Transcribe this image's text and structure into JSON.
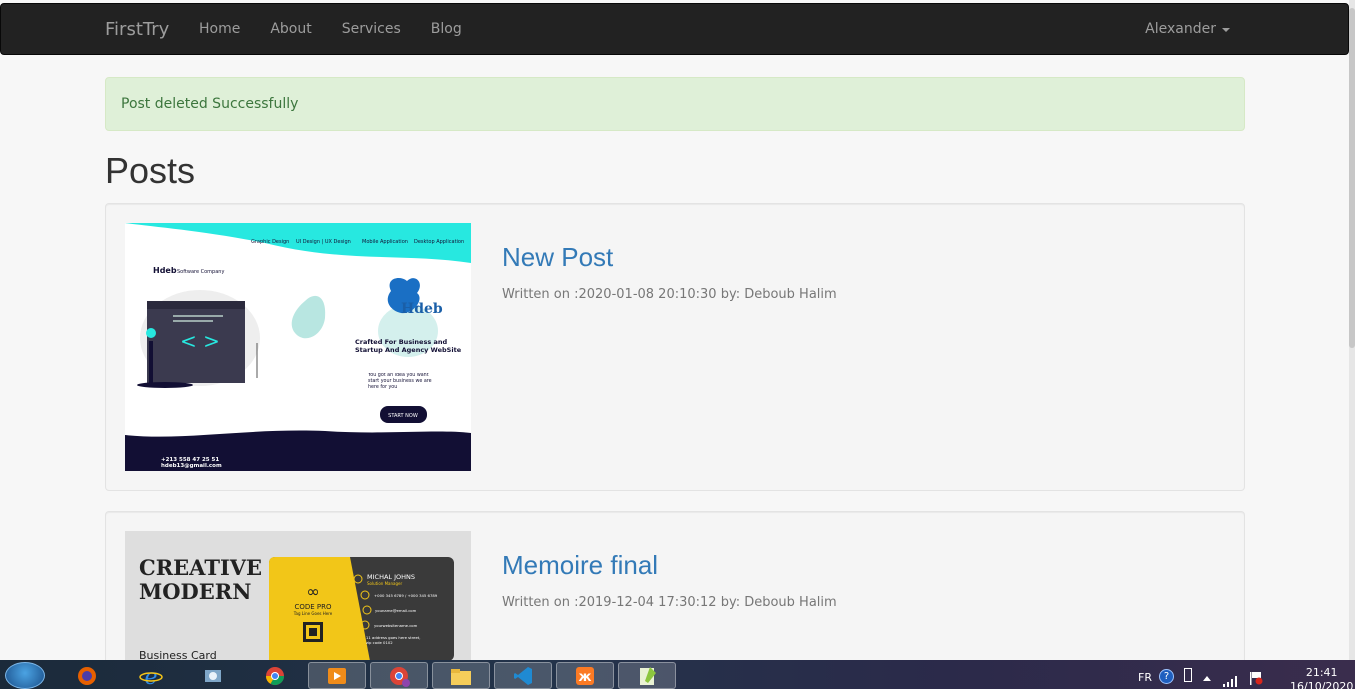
{
  "navbar": {
    "brand": "FirstTry",
    "links": [
      "Home",
      "About",
      "Services",
      "Blog"
    ],
    "user": "Alexander"
  },
  "alert": {
    "message": "Post deleted Successfully"
  },
  "page": {
    "title": "Posts"
  },
  "posts": [
    {
      "title": "New Post",
      "meta": "Written on :2020-01-08 20:10:30 by: Deboub Halim",
      "image": {
        "nav": [
          "Graphic Design",
          "UI Design | UX Design",
          "Mobile Application",
          "Desktop Application"
        ],
        "brand_small": "Hdeb",
        "brand_small_suffix": "Software Company",
        "logo_text": "Hdeb",
        "headline": "Crafted For Business and Startup And Agency WebSite",
        "subtext": "You got an idea you want start your business we are here for you",
        "cta": "START NOW",
        "phone": "+213 558 47 25 51",
        "email": "hdeb13@gmail.com"
      }
    },
    {
      "title": "Memoire final",
      "meta": "Written on :2019-12-04 17:30:12 by: Deboub Halim",
      "image": {
        "headline1": "CREATIVE",
        "headline2": "MODERN",
        "sub": "Business Card",
        "logo": "CODE PRO",
        "tagline": "Tag Line Goes Here",
        "name": "MICHAL JOHNS",
        "role": "Solution Manager",
        "phone": "+000 345 6789 / +000 345 6789",
        "email": "youname@email.com",
        "web": "yourwebsitename.com",
        "address": "11 address goes here street, zip code 0102"
      }
    }
  ],
  "taskbar": {
    "lang": "FR",
    "time": "21:41",
    "date": "16/10/2020"
  },
  "colors": {
    "navbar": "#222222",
    "link": "#337ab7",
    "alert_bg": "#dff0d8",
    "alert_text": "#3c763d"
  }
}
